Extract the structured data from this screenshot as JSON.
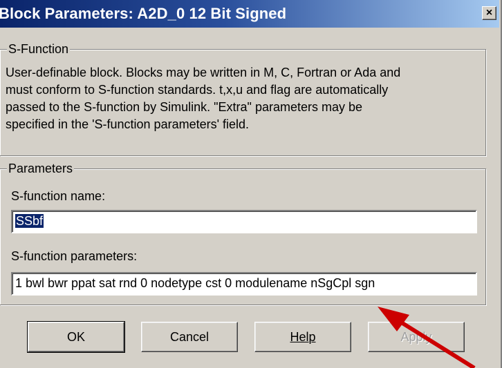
{
  "window": {
    "title": "Block Parameters: A2D_0 12 Bit Signed",
    "close_glyph": "×"
  },
  "sfunction_group": {
    "title": "S-Function",
    "description_lines": [
      "User-definable block.  Blocks may be written in M, C, Fortran or Ada and",
      "must  conform to S-function standards.  t,x,u and flag are automatically",
      "passed to the S-function by Simulink.  \"Extra\" parameters may be",
      "specified in the 'S-function parameters' field."
    ]
  },
  "parameters_group": {
    "title": "Parameters",
    "name_label": "S-function name:",
    "name_value": "SSbf",
    "params_label": "S-function parameters:",
    "params_value": "1 bwl bwr ppat sat rnd 0 nodetype cst 0 modulename nSgCpl sgn"
  },
  "buttons": {
    "ok": "OK",
    "cancel": "Cancel",
    "help": "Help",
    "apply": "Apply"
  },
  "annotation": {
    "arrow_color": "#cc0000"
  },
  "colors": {
    "dialog_bg": "#d4d0c8",
    "titlebar_start": "#0a246a",
    "titlebar_end": "#a6caf0",
    "selection": "#0a246a"
  }
}
